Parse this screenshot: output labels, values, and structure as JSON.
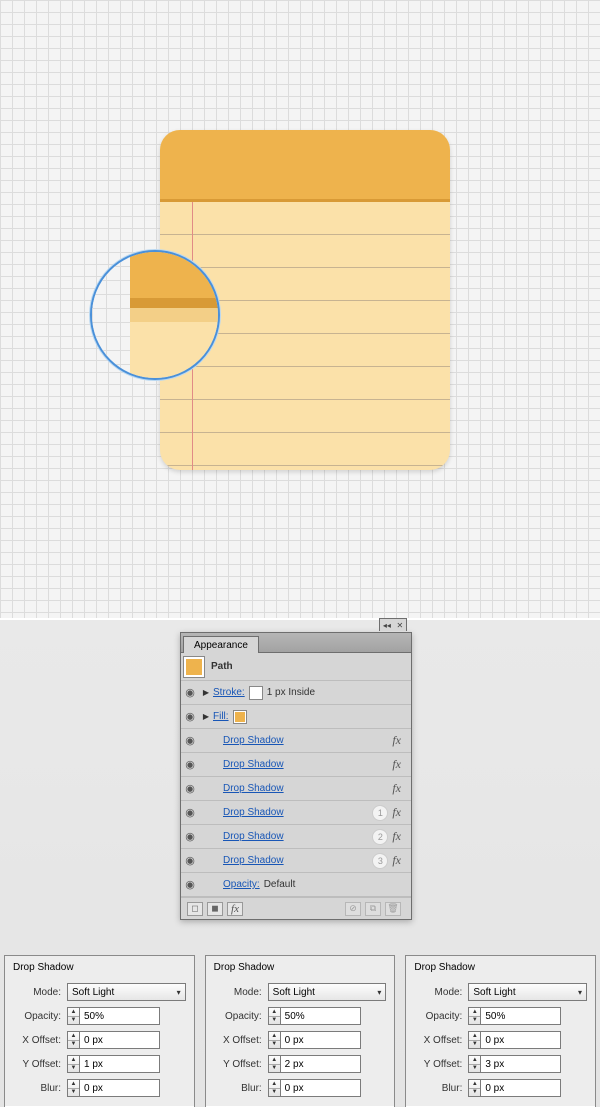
{
  "appearance": {
    "tab_label": "Appearance",
    "path_label": "Path",
    "stroke": {
      "label": "Stroke:",
      "value": "1 px  Inside",
      "swatch": "#ffffff"
    },
    "fill": {
      "label": "Fill:",
      "swatch": "#eeb34d"
    },
    "effects": [
      {
        "label": "Drop Shadow",
        "badge": ""
      },
      {
        "label": "Drop Shadow",
        "badge": ""
      },
      {
        "label": "Drop Shadow",
        "badge": ""
      },
      {
        "label": "Drop Shadow",
        "badge": "1"
      },
      {
        "label": "Drop Shadow",
        "badge": "2"
      },
      {
        "label": "Drop Shadow",
        "badge": "3"
      }
    ],
    "opacity_label": "Opacity:",
    "opacity_value": "Default",
    "fx_footer": "fx"
  },
  "dialogs": [
    {
      "title": "Drop Shadow",
      "mode_label": "Mode:",
      "mode_value": "Soft Light",
      "opacity_label": "Opacity:",
      "opacity_value": "50%",
      "xoff_label": "X Offset:",
      "xoff_value": "0 px",
      "yoff_label": "Y Offset:",
      "yoff_value": "1 px",
      "blur_label": "Blur:",
      "blur_value": "0 px"
    },
    {
      "title": "Drop Shadow",
      "mode_label": "Mode:",
      "mode_value": "Soft Light",
      "opacity_label": "Opacity:",
      "opacity_value": "50%",
      "xoff_label": "X Offset:",
      "xoff_value": "0 px",
      "yoff_label": "Y Offset:",
      "yoff_value": "2 px",
      "blur_label": "Blur:",
      "blur_value": "0 px"
    },
    {
      "title": "Drop Shadow",
      "mode_label": "Mode:",
      "mode_value": "Soft Light",
      "opacity_label": "Opacity:",
      "opacity_value": "50%",
      "xoff_label": "X Offset:",
      "xoff_value": "0 px",
      "yoff_label": "Y Offset:",
      "yoff_value": "3 px",
      "blur_label": "Blur:",
      "blur_value": "0 px"
    }
  ]
}
